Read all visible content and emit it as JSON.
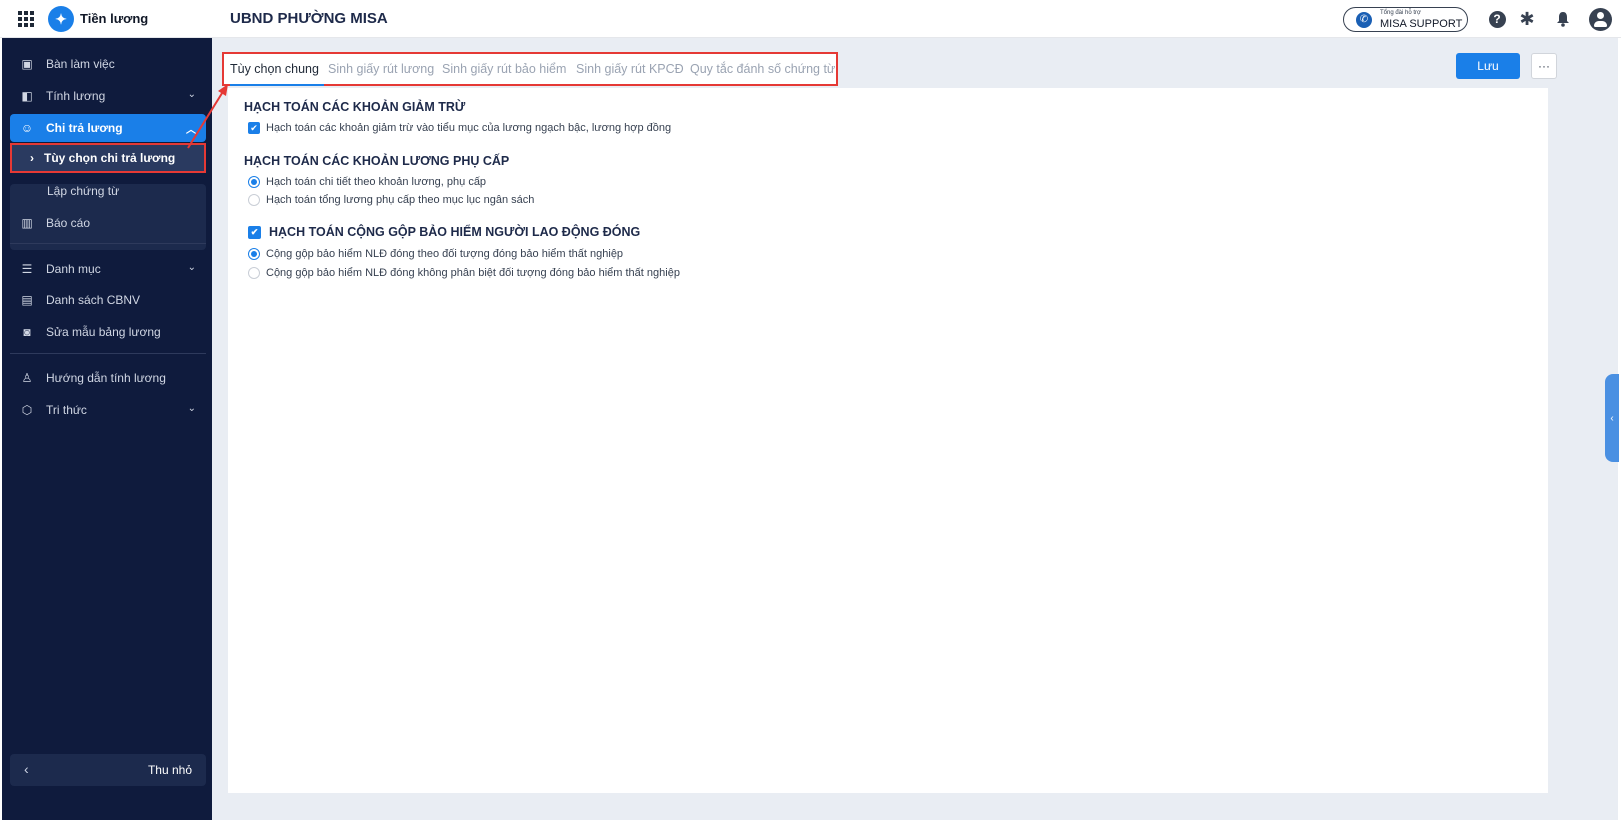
{
  "app": {
    "name": "Tiền lương",
    "org": "UBND PHƯỜNG MISA"
  },
  "support": {
    "small": "Tổng đài hỗ trợ",
    "label": "MISA SUPPORT"
  },
  "sidebar": {
    "items": [
      {
        "label": "Bàn làm việc",
        "icon": "dashboard-icon"
      },
      {
        "label": "Tính lương",
        "icon": "payroll-icon"
      },
      {
        "label": "Chi trả lương",
        "icon": "payment-icon"
      },
      {
        "label": "Báo cáo",
        "icon": "report-icon"
      },
      {
        "label": "Danh mục",
        "icon": "list-icon"
      },
      {
        "label": "Danh sách CBNV",
        "icon": "staff-icon"
      },
      {
        "label": "Sửa mẫu bảng lương",
        "icon": "template-icon"
      },
      {
        "label": "Hướng dẫn tính lương",
        "icon": "guide-icon"
      },
      {
        "label": "Tri thức",
        "icon": "knowledge-icon"
      }
    ],
    "sub_items": [
      {
        "label": "Tùy chọn chi trả lương"
      },
      {
        "label": "Lập chứng từ"
      }
    ],
    "collapse_label": "Thu nhỏ"
  },
  "tabs": [
    {
      "label": "Tùy chọn chung"
    },
    {
      "label": "Sinh giấy rút lương"
    },
    {
      "label": "Sinh giấy rút bảo hiểm"
    },
    {
      "label": "Sinh giấy rút KPCĐ"
    },
    {
      "label": "Quy tắc đánh số chứng từ"
    }
  ],
  "toolbar": {
    "save_label": "Lưu",
    "more_label": "···"
  },
  "sections": {
    "s1": {
      "title": "HẠCH TOÁN CÁC KHOẢN GIẢM TRỪ",
      "opt1": "Hạch toán các khoản giảm trừ vào tiểu mục của lương ngạch bậc, lương hợp đồng"
    },
    "s2": {
      "title": "HẠCH TOÁN CÁC KHOẢN LƯƠNG PHỤ CẤP",
      "opt1": "Hạch toán chi tiết theo khoản lương, phụ cấp",
      "opt2": "Hạch toán tổng lương phụ cấp theo mục lục ngân sách"
    },
    "s3": {
      "title": "HẠCH TOÁN CỘNG GỘP BẢO HIỂM NGƯỜI LAO ĐỘNG ĐÓNG",
      "opt1": "Cộng gộp bảo hiểm NLĐ đóng theo đối tượng đóng bảo hiểm thất nghiệp",
      "opt2": "Cộng gộp bảo hiểm NLĐ đóng không phân biệt đối tượng đóng bảo hiểm thất nghiệp"
    }
  },
  "colors": {
    "sidebar_bg": "#0f1b3d",
    "accent": "#1a7fe8",
    "highlight": "#e53935"
  }
}
